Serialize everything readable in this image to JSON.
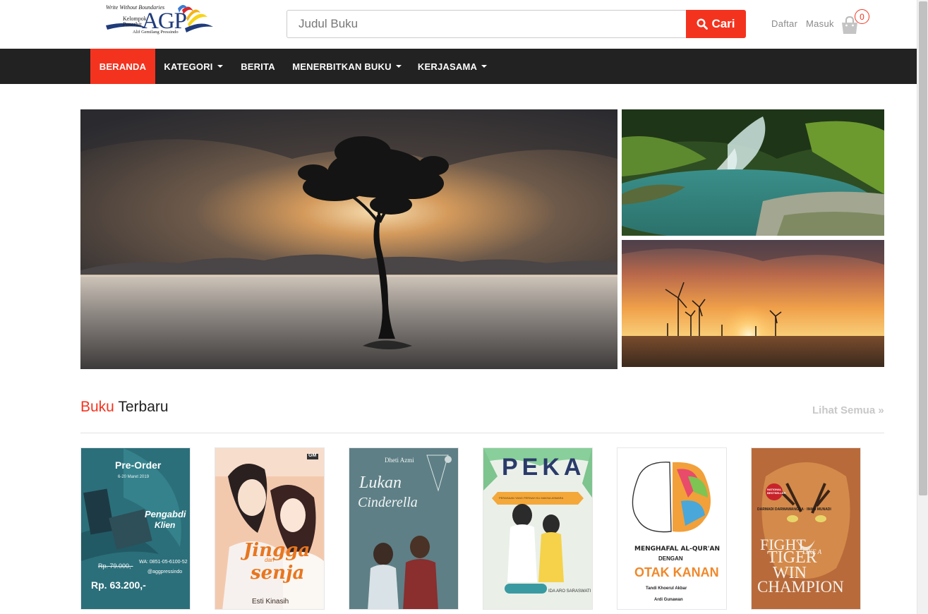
{
  "header": {
    "logo": {
      "tagline": "Write Without Boundaries",
      "line1": "Kelompok",
      "line2": "Penerbit",
      "brand": "AGP",
      "company": "Alif Gemilang Pressindo"
    },
    "search": {
      "placeholder": "Judul Buku",
      "button_label": "Cari"
    },
    "account": {
      "register": "Daftar",
      "login": "Masuk",
      "cart_count": "0"
    }
  },
  "nav": {
    "items": [
      {
        "label": "BERANDA",
        "active": true,
        "dropdown": false
      },
      {
        "label": "KATEGORI",
        "active": false,
        "dropdown": true
      },
      {
        "label": "BERITA",
        "active": false,
        "dropdown": false
      },
      {
        "label": "MENERBITKAN BUKU",
        "active": false,
        "dropdown": true
      },
      {
        "label": "KERJASAMA",
        "active": false,
        "dropdown": true
      }
    ]
  },
  "section": {
    "title_accent": "Buku",
    "title_rest": "Terbaru",
    "see_all": "Lihat Semua »"
  },
  "books": [
    {
      "cover": {
        "top": "Pre-Order",
        "dates": "6-20 Maret 2019",
        "title1": "Pengabdi",
        "title2": "Klien",
        "old_price": "Rp. 79.000,-",
        "price": "Rp. 63.200,-",
        "wa": "WA: 0851-05-6100-52",
        "ig": "@aggpressindo"
      }
    },
    {
      "cover": {
        "title1": "Jingga",
        "title2": "dan",
        "title3": "senja",
        "author": "Esti Kinasih",
        "publisher": "GM"
      }
    },
    {
      "cover": {
        "author": "Dheti Azmi",
        "title1": "Lukan",
        "title2": "Cinderella"
      }
    },
    {
      "cover": {
        "title": "PEKA",
        "subtitle": "PERASAAN YANG PERNAH KU MAKNA ASMARA",
        "author": "IDA ARO SARASWATI"
      }
    },
    {
      "cover": {
        "title1": "MENGHAFAL AL-QUR'AN",
        "title2": "DENGAN",
        "title3": "OTAK KANAN",
        "author1": "Tandi Khoerul Akbar",
        "author2": "Ardi Gunawan"
      }
    },
    {
      "cover": {
        "badge": "NATIONAL BESTSELLER",
        "authors": "DARMADI DARMAWANGSA · IMAM MUNADI",
        "title1": "FIGHT",
        "title2": "LIKE A",
        "title3": "TIGER",
        "title4": "WIN",
        "title5": "CHAMPION"
      }
    }
  ],
  "colors": {
    "accent": "#f4331f",
    "nav_bg": "#222222",
    "brand_blue": "#1f3b7a"
  },
  "icons": {
    "search": "search-icon",
    "cart": "shopping-bag-icon",
    "caret": "caret-down-icon"
  }
}
